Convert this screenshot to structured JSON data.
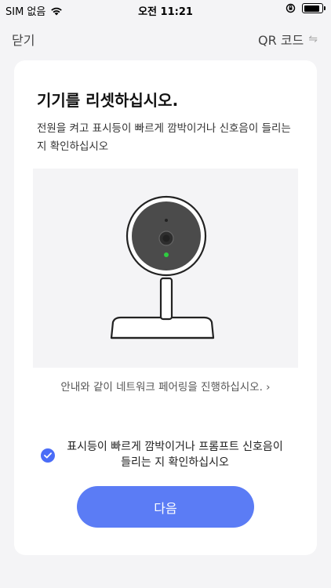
{
  "status_bar": {
    "carrier": "SIM 없음",
    "time": "오전 11:21"
  },
  "nav": {
    "close_label": "닫기",
    "qr_label": "QR 코드"
  },
  "card": {
    "title": "기기를 리셋하십시오.",
    "description": "전원을 켜고 표시등이 빠르게 깜박이거나 신호음이 들리는 지 확인하십시오",
    "guide_link": "안내와 같이 네트워크 페어링을 진행하십시오.  ›",
    "confirm_text": "표시등이 빠르게 깜박이거나 프롬프트 신호음이 들리는 지 확인하십시오",
    "confirm_checked": true,
    "next_label": "다음"
  },
  "colors": {
    "accent": "#5b7cf5",
    "check": "#4a6cf7",
    "led": "#2ecc40",
    "background": "#f4f4f6"
  }
}
